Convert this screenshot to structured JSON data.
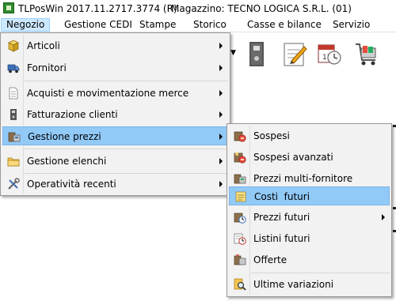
{
  "window": {
    "title_app": "TLPosWin 2017.11.2717.3774 (R)",
    "title_store": "Magazzino: TECNO LOGICA S.R.L. (01)"
  },
  "menubar": {
    "items": [
      {
        "label": "Negozio"
      },
      {
        "label": "Gestione CEDI"
      },
      {
        "label": "Stampe"
      },
      {
        "label": "Storico"
      },
      {
        "label": "Casse e bilance"
      },
      {
        "label": "Servizio"
      }
    ]
  },
  "toolbar": {
    "icons": [
      "binder-icon",
      "notepad-pencil-icon",
      "calendar-clock-icon",
      "shopping-cart-icon"
    ]
  },
  "negozio_menu": {
    "items": [
      {
        "label": "Articoli",
        "icon": "box-icon",
        "submenu": true
      },
      {
        "label": "Fornitori",
        "icon": "truck-icon",
        "submenu": true
      },
      {
        "label": "Acquisti e movimentazione merce",
        "icon": "document-icon",
        "submenu": true
      },
      {
        "label": "Fatturazione clienti",
        "icon": "binder-icon",
        "submenu": true
      },
      {
        "label": "Gestione prezzi",
        "icon": "price-register-icon",
        "submenu": true,
        "highlighted": true
      },
      {
        "label": "Gestione elenchi",
        "icon": "folder-icon",
        "submenu": true
      },
      {
        "label": "Operatività recenti",
        "icon": "tools-icon",
        "submenu": true
      }
    ]
  },
  "prezzi_submenu": {
    "items": [
      {
        "label": "Sospesi",
        "icon": "suspended-icon"
      },
      {
        "label": "Sospesi avanzati",
        "icon": "suspended-advanced-icon"
      },
      {
        "label": "Prezzi multi-fornitore",
        "icon": "multi-supplier-icon"
      },
      {
        "label": "Costi  futuri",
        "icon": "note-icon",
        "highlighted": true
      },
      {
        "label": "Prezzi futuri",
        "icon": "future-prices-icon",
        "submenu": true
      },
      {
        "label": "Listini futuri",
        "icon": "future-lists-icon"
      },
      {
        "label": "Offerte",
        "icon": "offers-icon"
      },
      {
        "label": "Ultime variazioni",
        "icon": "magnifier-icon"
      }
    ]
  }
}
